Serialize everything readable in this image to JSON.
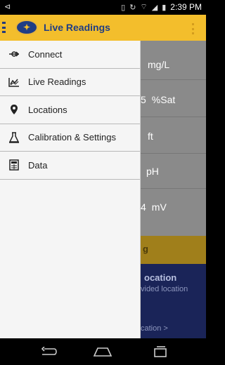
{
  "status_bar": {
    "time": "2:39 PM"
  },
  "app_bar": {
    "title": "Live Readings"
  },
  "drawer": {
    "items": [
      {
        "label": "Connect",
        "icon": "connect-icon"
      },
      {
        "label": "Live Readings",
        "icon": "chart-icon"
      },
      {
        "label": "Locations",
        "icon": "location-pin-icon"
      },
      {
        "label": "Calibration & Settings",
        "icon": "flask-icon"
      },
      {
        "label": "Data",
        "icon": "data-icon"
      }
    ]
  },
  "background": {
    "readings": [
      {
        "num": "",
        "unit": "mg/L"
      },
      {
        "num": "5",
        "unit": "%Sat"
      },
      {
        "num": "",
        "unit": "ft"
      },
      {
        "num": "",
        "unit": "pH"
      },
      {
        "num": "4",
        "unit": "mV"
      }
    ],
    "band_text": "g",
    "location_title": "ocation",
    "location_sub": "vided location",
    "location_link": "cation >"
  },
  "colors": {
    "accent": "#f3be2c",
    "brand_blue": "#1f3d85"
  }
}
